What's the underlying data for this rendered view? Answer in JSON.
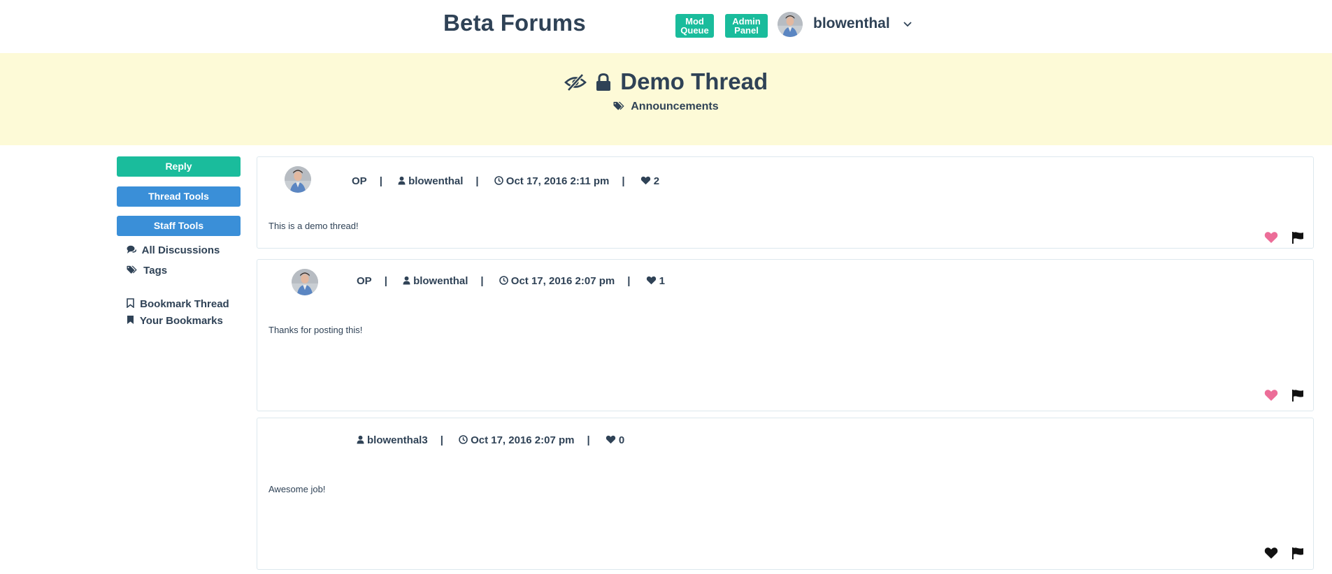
{
  "header": {
    "brand": "Beta Forums",
    "mod_queue": [
      "Mod",
      "Queue"
    ],
    "admin_panel": [
      "Admin",
      "Panel"
    ],
    "username": "blowenthal"
  },
  "thread": {
    "title": "Demo Thread",
    "tag": "Announcements"
  },
  "sidebar": {
    "reply": "Reply",
    "thread_tools": "Thread Tools",
    "staff_tools": "Staff Tools",
    "all_discussions": "All Discussions",
    "tags": "Tags",
    "bookmark_thread": "Bookmark Thread",
    "your_bookmarks": "Your Bookmarks"
  },
  "posts": [
    {
      "badge": "OP",
      "author": "blowenthal",
      "date": "Oct 17, 2016 2:11 pm",
      "likes": "2",
      "body": "This is a demo thread!",
      "liked": true
    },
    {
      "badge": "OP",
      "author": "blowenthal",
      "date": "Oct 17, 2016 2:07 pm",
      "likes": "1",
      "body": "Thanks for posting this!",
      "liked": true
    },
    {
      "badge": "",
      "author": "blowenthal3",
      "date": "Oct 17, 2016 2:07 pm",
      "likes": "0",
      "body": "Awesome job!",
      "liked": false
    }
  ],
  "colors": {
    "accent_green": "#1abc9c",
    "accent_blue": "#3a8fd8",
    "banner": "#fdfad7",
    "text": "#2f4256",
    "liked_heart": "#ec6d98"
  }
}
